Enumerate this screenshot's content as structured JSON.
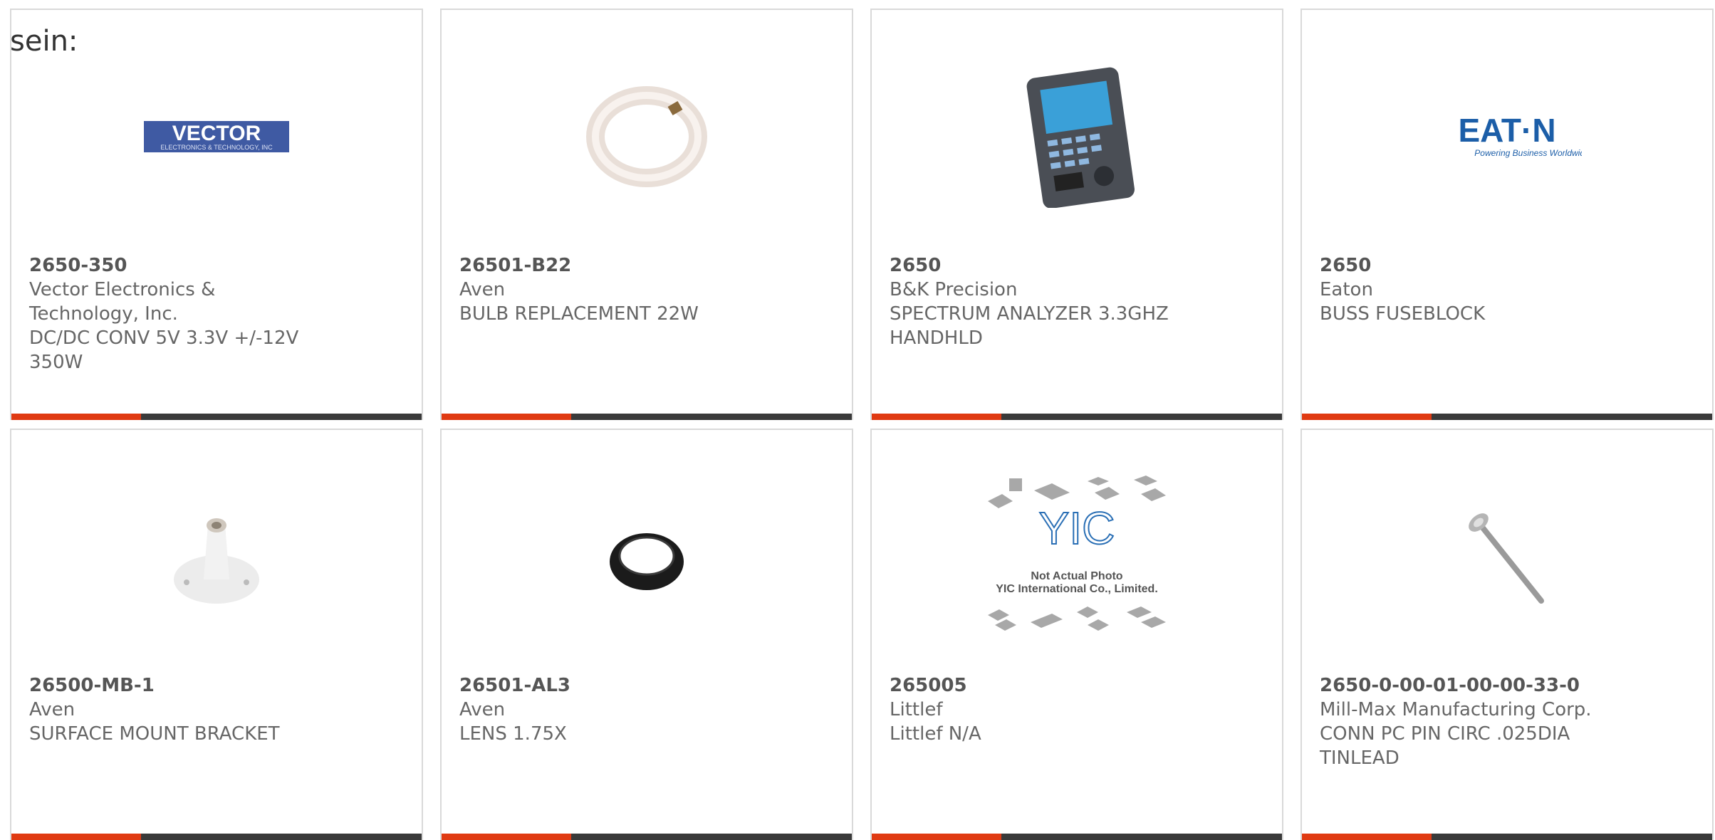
{
  "intro_text": "sein:",
  "colors": {
    "accent": "#e03a12",
    "bar": "#3a3a3a",
    "border": "#d9d9d9"
  },
  "products": [
    {
      "part_number": "2650-350",
      "manufacturer": "Vector Electronics & Technology, Inc.",
      "description": "DC/DC CONV 5V 3.3V +/-12V 350W",
      "image": "vector-logo",
      "logo_text": "VECTOR",
      "logo_subtext": "ELECTRONICS & TECHNOLOGY, INC"
    },
    {
      "part_number": "26501-B22",
      "manufacturer": "Aven",
      "description": "BULB REPLACEMENT 22W",
      "image": "circular-bulb-photo"
    },
    {
      "part_number": "2650",
      "manufacturer": "B&K Precision",
      "description": "SPECTRUM ANALYZER 3.3GHZ HANDHLD",
      "image": "spectrum-analyzer-photo"
    },
    {
      "part_number": "2650",
      "manufacturer": "Eaton",
      "description": "BUSS FUSEBLOCK",
      "image": "eaton-logo",
      "logo_text": "EAT·N",
      "logo_subtext": "Powering Business Worldwide"
    },
    {
      "part_number": "26500-MB-1",
      "manufacturer": "Aven",
      "description": "SURFACE MOUNT BRACKET",
      "image": "mount-bracket-photo"
    },
    {
      "part_number": "26501-AL3",
      "manufacturer": "Aven",
      "description": "LENS 1.75X",
      "image": "lens-ring-photo"
    },
    {
      "part_number": "265005",
      "manufacturer": "Littlef",
      "description": "Littlef N/A",
      "image": "yic-placeholder",
      "logo_text": "YIC",
      "logo_subtext": "Not Actual Photo",
      "logo_subtext2": "YIC International Co., Limited."
    },
    {
      "part_number": "2650-0-00-01-00-00-33-0",
      "manufacturer": "Mill-Max Manufacturing Corp.",
      "description": "CONN PC PIN CIRC .025DIA TINLEAD",
      "image": "pc-pin-photo"
    }
  ]
}
